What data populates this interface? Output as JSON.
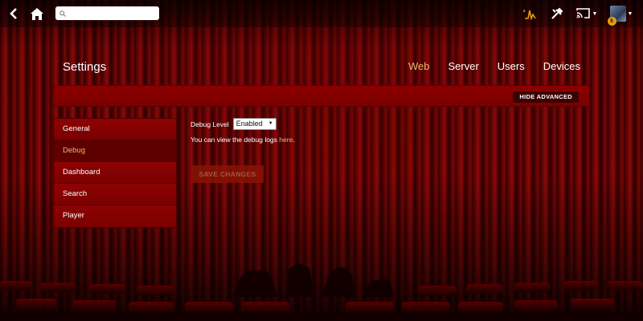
{
  "topbar": {
    "search": {
      "value": "",
      "placeholder": ""
    },
    "avatar_badge": "6"
  },
  "header": {
    "title": "Settings",
    "tabs": [
      {
        "label": "Web",
        "active": true
      },
      {
        "label": "Server",
        "active": false
      },
      {
        "label": "Users",
        "active": false
      },
      {
        "label": "Devices",
        "active": false
      }
    ]
  },
  "banner": {
    "hide_advanced_label": "HIDE ADVANCED"
  },
  "sidebar": {
    "items": [
      {
        "label": "General",
        "active": false
      },
      {
        "label": "Debug",
        "active": true
      },
      {
        "label": "Dashboard",
        "active": false
      },
      {
        "label": "Search",
        "active": false
      },
      {
        "label": "Player",
        "active": false
      }
    ]
  },
  "main": {
    "debug_label": "Debug Level",
    "debug_value": "Enabled",
    "logs_text": "You can view the debug logs ",
    "logs_link": "here",
    "logs_suffix": ".",
    "save_label": "SAVE CHANGES"
  },
  "colors": {
    "accent": "#e9b96e",
    "curtain": "#7a0707",
    "panel": "#7e0000"
  },
  "icons": [
    "chevron-left-icon",
    "home-icon",
    "search-icon",
    "activity-icon",
    "tools-icon",
    "cast-icon",
    "avatar",
    "caret-down-icon"
  ]
}
